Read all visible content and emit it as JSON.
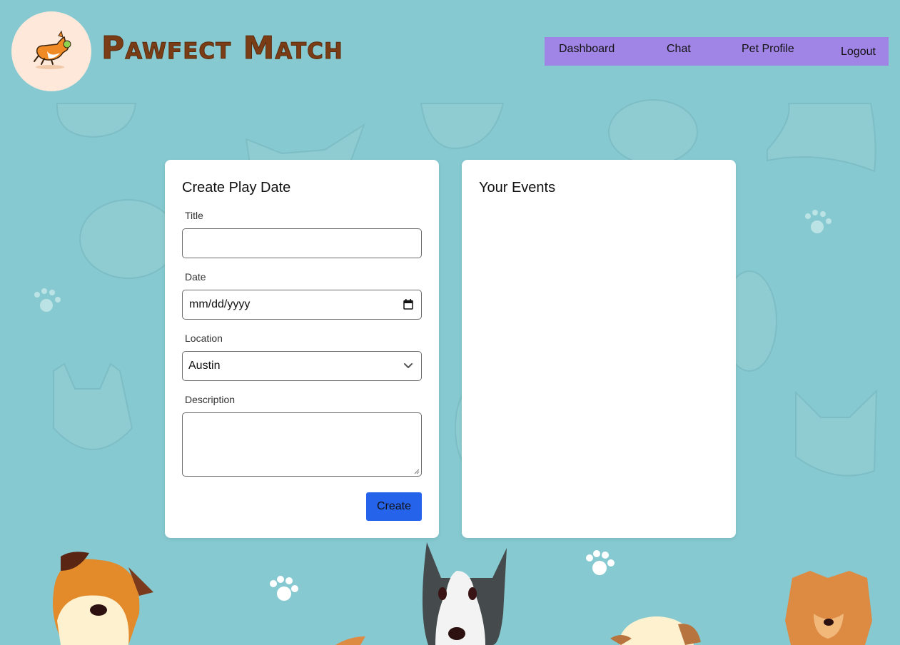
{
  "brand": {
    "name": "Pawfect Match"
  },
  "nav": {
    "items": [
      {
        "label": "Dashboard"
      },
      {
        "label": "Chat"
      },
      {
        "label": "Pet Profile"
      },
      {
        "label": "Logout"
      }
    ]
  },
  "create_form": {
    "heading": "Create Play Date",
    "title_label": "Title",
    "title_value": "",
    "date_label": "Date",
    "date_placeholder": "mm/dd/yyyy",
    "location_label": "Location",
    "location_value": "Austin",
    "description_label": "Description",
    "description_value": "",
    "submit_label": "Create"
  },
  "events": {
    "heading": "Your Events",
    "items": []
  },
  "colors": {
    "background": "#86c9d1",
    "nav_bg": "#a185e6",
    "brand_text": "#7a3d16",
    "primary_button": "#2563eb",
    "logo_circle": "#fde8da"
  },
  "icons": [
    "corgi-logo-icon",
    "calendar-icon",
    "chevron-down-icon",
    "paw-print-icon",
    "dog-illustration"
  ]
}
